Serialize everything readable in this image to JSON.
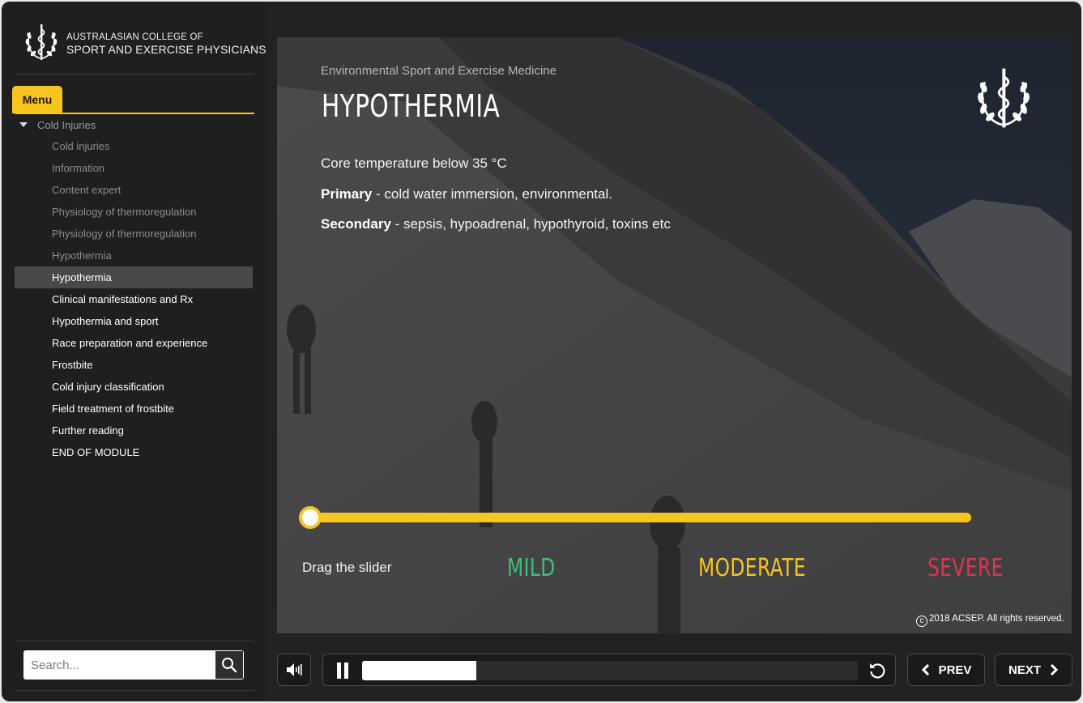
{
  "brand": {
    "line1": "AUSTRALASIAN COLLEGE OF",
    "line2": "SPORT AND EXERCISE PHYSICIANS"
  },
  "menu": {
    "tab_label": "Menu",
    "section_label": "Cold Injuries",
    "items": [
      {
        "label": "Cold injuries",
        "state": "visited"
      },
      {
        "label": "Information",
        "state": "visited"
      },
      {
        "label": "Content expert",
        "state": "visited"
      },
      {
        "label": "Physiology of thermoregulation",
        "state": "visited"
      },
      {
        "label": "Physiology of thermoregulation",
        "state": "visited"
      },
      {
        "label": "Hypothermia",
        "state": "visited"
      },
      {
        "label": "Hypothermia",
        "state": "active"
      },
      {
        "label": "Clinical manifestations and Rx",
        "state": "unvisited"
      },
      {
        "label": "Hypothermia and sport",
        "state": "unvisited"
      },
      {
        "label": "Race preparation and experience",
        "state": "unvisited"
      },
      {
        "label": "Frostbite",
        "state": "unvisited"
      },
      {
        "label": "Cold injury classification",
        "state": "unvisited"
      },
      {
        "label": "Field treatment of frostbite",
        "state": "unvisited"
      },
      {
        "label": "Further reading",
        "state": "unvisited"
      },
      {
        "label": "END OF MODULE",
        "state": "unvisited"
      }
    ]
  },
  "search": {
    "placeholder": "Search...",
    "value": ""
  },
  "slide": {
    "subtitle": "Environmental Sport and Exercise Medicine",
    "title": "HYPOTHERMIA",
    "lines": [
      {
        "bold": "",
        "text": "Core temperature below 35 °C"
      },
      {
        "bold": "Primary",
        "text": " - cold water immersion, environmental."
      },
      {
        "bold": "Secondary",
        "text": " - sepsis, hypoadrenal, hypothyroid, toxins etc"
      }
    ],
    "slider": {
      "instruction": "Drag the slider",
      "value": 0,
      "levels": [
        {
          "label": "MILD",
          "color": "#3fbf7a"
        },
        {
          "label": "MODERATE",
          "color": "#f7c51e"
        },
        {
          "label": "SEVERE",
          "color": "#e0344f"
        }
      ]
    },
    "copyright": "2018 ACSEP. All rights reserved."
  },
  "player": {
    "progress": 0.23,
    "prev_label": "PREV",
    "next_label": "NEXT",
    "volume_icon": "speaker-icon",
    "pause_icon": "pause-icon",
    "replay_icon": "replay-icon"
  },
  "colors": {
    "accent": "#f7c51e",
    "sidebar_bg": "#1f1f1f",
    "active_item_bg": "#494949"
  }
}
